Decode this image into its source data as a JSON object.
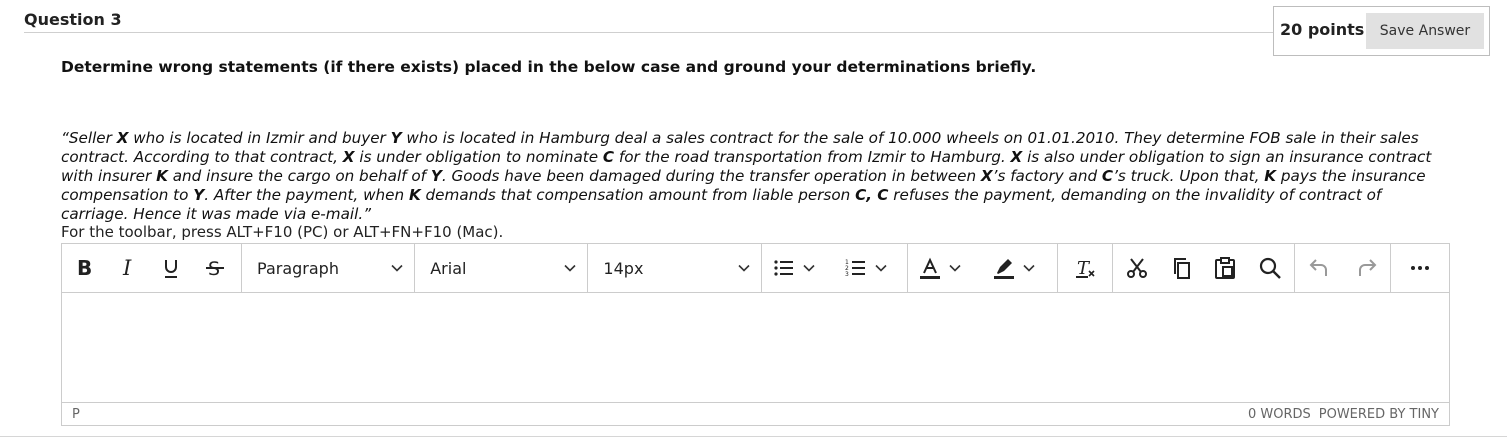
{
  "question": {
    "title": "Question 3",
    "points": "20 points",
    "save_label": "Save Answer",
    "prompt": "Determine wrong statements (if there exists) placed in the below case and ground your determinations briefly.",
    "case_text": [
      {
        "t": "“Seller ",
        "b": false
      },
      {
        "t": "X",
        "b": true
      },
      {
        "t": " who is located in Izmir and buyer ",
        "b": false
      },
      {
        "t": "Y",
        "b": true
      },
      {
        "t": " who is located in Hamburg deal a sales contract for the sale of 10.000 wheels on 01.01.2010. They determine FOB sale in their sales contract. According to that contract, ",
        "b": false
      },
      {
        "t": "X",
        "b": true
      },
      {
        "t": " is under obligation to nominate ",
        "b": false
      },
      {
        "t": "C",
        "b": true
      },
      {
        "t": " for the road transportation from Izmir to Hamburg. ",
        "b": false
      },
      {
        "t": "X",
        "b": true
      },
      {
        "t": " is also under obligation to sign an insurance contract with insurer ",
        "b": false
      },
      {
        "t": "K",
        "b": true
      },
      {
        "t": " and insure the cargo on behalf of ",
        "b": false
      },
      {
        "t": "Y",
        "b": true
      },
      {
        "t": ". Goods have been damaged during the transfer operation in between ",
        "b": false
      },
      {
        "t": "X",
        "b": true
      },
      {
        "t": "’s factory and ",
        "b": false
      },
      {
        "t": "C",
        "b": true
      },
      {
        "t": "’s truck. Upon that, ",
        "b": false
      },
      {
        "t": "K",
        "b": true
      },
      {
        "t": " pays the insurance compensation to ",
        "b": false
      },
      {
        "t": "Y",
        "b": true
      },
      {
        "t": ". After the payment, when ",
        "b": false
      },
      {
        "t": "K",
        "b": true
      },
      {
        "t": " demands that compensation amount from liable person ",
        "b": false
      },
      {
        "t": "C, C",
        "b": true
      },
      {
        "t": " refuses the payment, demanding on the invalidity of contract of carriage. Hence it was made via e-mail.”",
        "b": false
      }
    ]
  },
  "editor": {
    "toolbar_hint": "For the toolbar, press ALT+F10 (PC) or ALT+FN+F10 (Mac).",
    "block_format": "Paragraph",
    "font_family": "Arial",
    "font_size": "14px",
    "path": "P",
    "word_count": "0 WORDS",
    "powered_by": "POWERED BY TINY"
  }
}
